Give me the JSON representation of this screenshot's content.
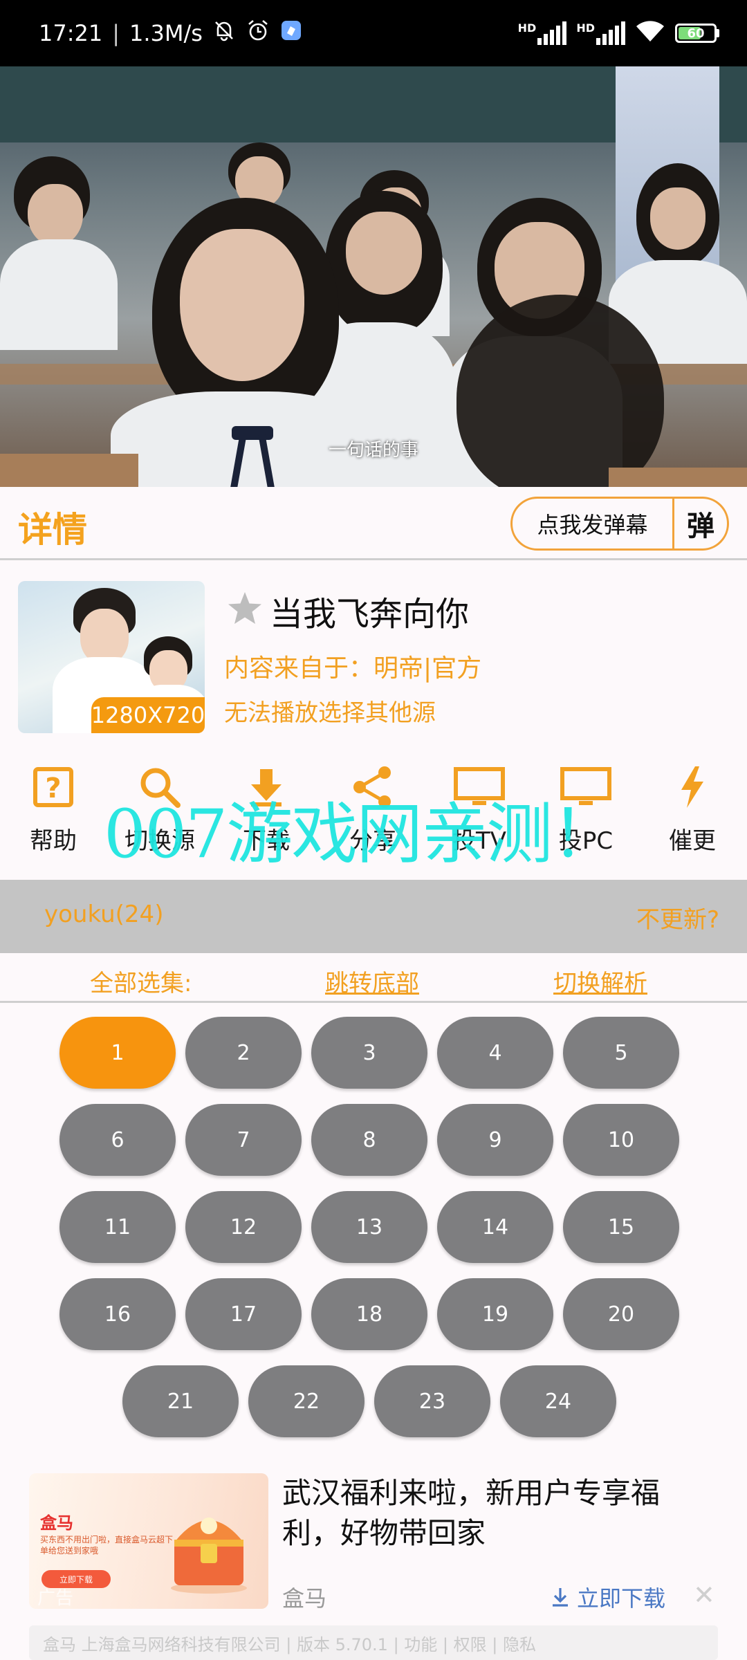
{
  "status_bar": {
    "time": "17:21",
    "speed": "1.3M/s",
    "signal1_label": "HD",
    "signal2_label": "HD",
    "battery": "60",
    "battery_level_fraction": 0.6,
    "icons": [
      "mute-bell-icon",
      "alarm-icon",
      "app-notification-icon",
      "signal-icon",
      "signal-icon",
      "wifi-icon",
      "battery-icon"
    ]
  },
  "video": {
    "subtitle": "一句话的事"
  },
  "details": {
    "title": "详情",
    "danmu_button": "点我发弹幕",
    "danmu_short": "弹"
  },
  "show": {
    "resolution": "1280X720",
    "title": "当我飞奔向你",
    "source": "内容来自于：明帝|官方",
    "fail_hint": "无法播放选择其他源",
    "star_color": "#bdbdbd"
  },
  "actions": [
    {
      "label": "帮助",
      "icon": "help-icon"
    },
    {
      "label": "切换源",
      "icon": "search-icon"
    },
    {
      "label": "下载",
      "icon": "download-icon"
    },
    {
      "label": "分享",
      "icon": "share-icon"
    },
    {
      "label": "投TV",
      "icon": "tv-cast-icon"
    },
    {
      "label": "投PC",
      "icon": "pc-cast-icon"
    },
    {
      "label": "催更",
      "icon": "lightning-icon"
    }
  ],
  "watermark": "007游戏网亲测！",
  "source_bar": {
    "name": "youku(24)",
    "no_update": "不更新?"
  },
  "episode_controls": {
    "all": "全部选集:",
    "jump": "跳转底部",
    "switch": "切换解析"
  },
  "episodes": [
    "1",
    "2",
    "3",
    "4",
    "5",
    "6",
    "7",
    "8",
    "9",
    "10",
    "11",
    "12",
    "13",
    "14",
    "15",
    "16",
    "17",
    "18",
    "19",
    "20",
    "21",
    "22",
    "23",
    "24"
  ],
  "active_episode": "1",
  "colors": {
    "accent": "#f2a021",
    "episode_active": "#f7940e",
    "episode_default": "#7e7e80",
    "watermark": "#1fe6e0"
  },
  "ad": {
    "headline": "武汉福利来啦，新用户专享福利，好物带回家",
    "brand": "盒马",
    "download": "立即下载",
    "close": "✕",
    "image_brand": "盒马",
    "image_sub": "买东西不用出门啦，直接盒马云超下单给您送到家哦",
    "image_button": "立即下载",
    "image_tag": "广告",
    "footer": "盒马 上海盒马网络科技有限公司 | 版本 5.70.1 | 功能 | 权限 | 隐私"
  }
}
